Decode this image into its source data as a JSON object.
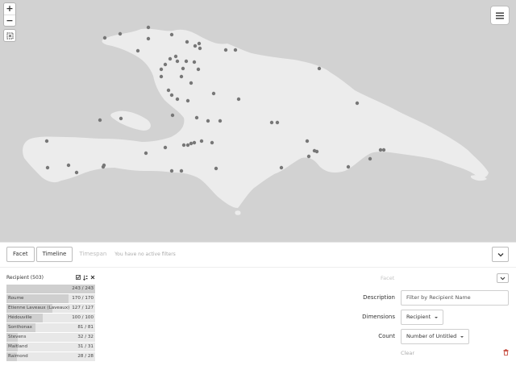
{
  "map": {
    "zoom_in_label": "+",
    "zoom_out_label": "−",
    "colors": {
      "water": "#d2d2d2",
      "land": "#ececec",
      "marker": "#777777"
    }
  },
  "toolbar": {
    "facet_tab": "Facet",
    "timeline_tab": "Timeline",
    "timespan_tab": "Timespan",
    "filters_note": "You have no active filters"
  },
  "facet": {
    "title": "Recipient (503)",
    "total": 243,
    "rows": [
      {
        "label": "",
        "count": "243 / 243",
        "fraction": 1.0
      },
      {
        "label": "Roume",
        "count": "170 / 170",
        "fraction": 0.7
      },
      {
        "label": "Etienne Laveaux (Laveaux)",
        "count": "127 / 127",
        "fraction": 0.52
      },
      {
        "label": "Hédouville",
        "count": "100 / 100",
        "fraction": 0.41
      },
      {
        "label": "Sonthonax",
        "count": "81 / 81",
        "fraction": 0.33
      },
      {
        "label": "Stevens",
        "count": "32 / 32",
        "fraction": 0.13
      },
      {
        "label": "Maitland",
        "count": "31 / 31",
        "fraction": 0.13
      },
      {
        "label": "Raimond",
        "count": "28 / 28",
        "fraction": 0.12
      }
    ]
  },
  "settings": {
    "facet_label": "Facet",
    "description_label": "Description",
    "description_placeholder": "Filter by Recipient Name",
    "dimensions_label": "Dimensions",
    "dimensions_value": "Recipient",
    "count_label": "Count",
    "count_value": "Number of Untitled",
    "clear_label": "Clear"
  }
}
